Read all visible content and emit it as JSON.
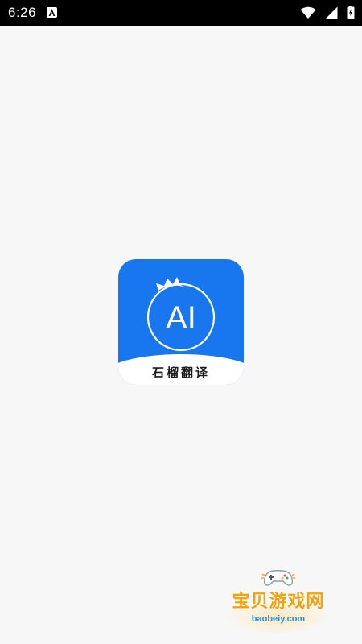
{
  "status_bar": {
    "time": "6:26",
    "icons": [
      "app-notification-icon",
      "wifi-icon",
      "signal-icon",
      "battery-icon"
    ]
  },
  "splash": {
    "logo_text": "AI",
    "app_name": "石榴翻译",
    "accent_color": "#1877ee"
  },
  "watermark": {
    "title": "宝贝游戏网",
    "url": "baobeiy.com"
  }
}
